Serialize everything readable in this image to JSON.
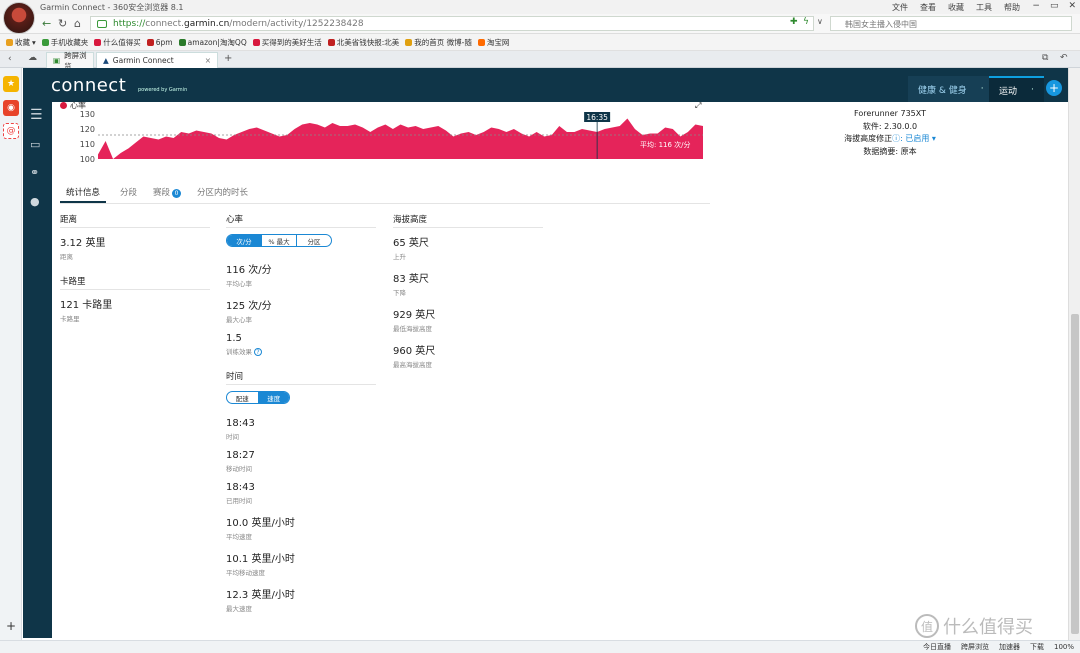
{
  "window": {
    "title": "Garmin Connect - 360安全浏览器 8.1",
    "menu": [
      "文件",
      "查看",
      "收藏",
      "工具",
      "帮助"
    ]
  },
  "address": {
    "url_scheme": "https://",
    "url_host_pre": "connect.",
    "url_host": "garmin.cn",
    "url_path": "/modern/activity/1252238428",
    "search_placeholder": "韩国女主播入侵中国"
  },
  "bookmarks": [
    {
      "label": "收藏",
      "color": "#e8a020"
    },
    {
      "label": "手机收藏夹",
      "color": "#3a9a3a"
    },
    {
      "label": "什么值得买",
      "color": "#d8193e"
    },
    {
      "label": "6pm",
      "color": "#c02020"
    },
    {
      "label": "amazon|淘淘QQ",
      "color": "#2a7a2a"
    },
    {
      "label": "买得到的美好生活",
      "color": "#d8193e"
    },
    {
      "label": "北美省钱快报:北美",
      "color": "#c02020"
    },
    {
      "label": "我的首页 微博-随",
      "color": "#e0a010"
    },
    {
      "label": "淘宝网",
      "color": "#ff6a00"
    }
  ],
  "tabs": [
    {
      "label": "跨屏浏览"
    },
    {
      "label": "Garmin Connect"
    }
  ],
  "gnav": {
    "logo": "connect",
    "powered": "powered by Garmin",
    "health": "健康 & 健身",
    "sport": "运动"
  },
  "chart_data": {
    "type": "area",
    "title": "心率",
    "color": "#e5245a",
    "ylim": [
      100,
      130
    ],
    "yticks": [
      "130",
      "120",
      "110",
      "100"
    ],
    "average_label": "平均: 116 次/分",
    "average": 116,
    "cursor_label": "16:35",
    "x": [
      0,
      1,
      2,
      3,
      4,
      5,
      6,
      7,
      8,
      9,
      10,
      11,
      12,
      13,
      14,
      15,
      16,
      17,
      18,
      19,
      20,
      21,
      22,
      23,
      24,
      25,
      26,
      27,
      28,
      29,
      30,
      31,
      32,
      33,
      34,
      35,
      36,
      37,
      38,
      39,
      40,
      41,
      42,
      43,
      44,
      45,
      46,
      47,
      48,
      49,
      50,
      51,
      52,
      53,
      54,
      55,
      56,
      57,
      58,
      59,
      60,
      61,
      62,
      63,
      64,
      65,
      66,
      67,
      68,
      69,
      70,
      71,
      72,
      73,
      74,
      75,
      76,
      77,
      78,
      79,
      80
    ],
    "values": [
      103,
      112,
      100,
      104,
      107,
      111,
      115,
      114,
      113,
      115,
      114,
      118,
      117,
      119,
      118,
      117,
      114,
      113,
      116,
      118,
      120,
      121,
      119,
      117,
      115,
      116,
      120,
      123,
      124,
      123,
      121,
      124,
      122,
      122,
      123,
      121,
      118,
      121,
      123,
      120,
      123,
      121,
      122,
      120,
      121,
      122,
      119,
      115,
      117,
      118,
      116,
      118,
      121,
      120,
      118,
      120,
      117,
      115,
      118,
      115,
      116,
      122,
      118,
      118,
      120,
      119,
      118,
      120,
      121,
      122,
      127,
      120,
      116,
      117,
      117,
      121,
      120,
      115,
      118,
      123,
      122
    ]
  },
  "device": {
    "name": "Forerunner 735XT",
    "software": "软件: 2.30.0.0",
    "elev_label": "海拔高度修正",
    "elev_value": ": 已启用",
    "summary": "数据摘要: 原本"
  },
  "subtabs": [
    "统计信息",
    "分段",
    "赛段",
    "分区内的时长"
  ],
  "segments_badge": "0",
  "distance": {
    "header": "距离",
    "value": "3.12 英里",
    "label": "距离"
  },
  "calories": {
    "header": "卡路里",
    "value": "121 卡路里",
    "label": "卡路里"
  },
  "heart": {
    "header": "心率",
    "toggle": [
      "次/分",
      "% 最大",
      "分区"
    ],
    "stats": [
      {
        "value": "116 次/分",
        "label": "平均心率"
      },
      {
        "value": "125 次/分",
        "label": "最大心率"
      },
      {
        "value": "1.5",
        "label": "训练效果"
      }
    ]
  },
  "elevation": {
    "header": "海拔高度",
    "stats": [
      {
        "value": "65 英尺",
        "label": "上升"
      },
      {
        "value": "83 英尺",
        "label": "下降"
      },
      {
        "value": "929 英尺",
        "label": "最低海拔高度"
      },
      {
        "value": "960 英尺",
        "label": "最高海拔高度"
      }
    ]
  },
  "time": {
    "header": "时间",
    "toggle": [
      "配速",
      "速度"
    ],
    "stats": [
      {
        "value": "18:43",
        "label": "时间"
      },
      {
        "value": "18:27",
        "label": "移动时间"
      },
      {
        "value": "18:43",
        "label": "已用时间"
      },
      {
        "value": "10.0 英里/小时",
        "label": "平均速度"
      },
      {
        "value": "10.1 英里/小时",
        "label": "平均移动速度"
      },
      {
        "value": "12.3 英里/小时",
        "label": "最大速度"
      }
    ]
  },
  "statusbar": [
    "今日直播",
    "跨屏浏览",
    "加速器",
    "下载",
    "100%"
  ],
  "watermark": "什么值得买"
}
